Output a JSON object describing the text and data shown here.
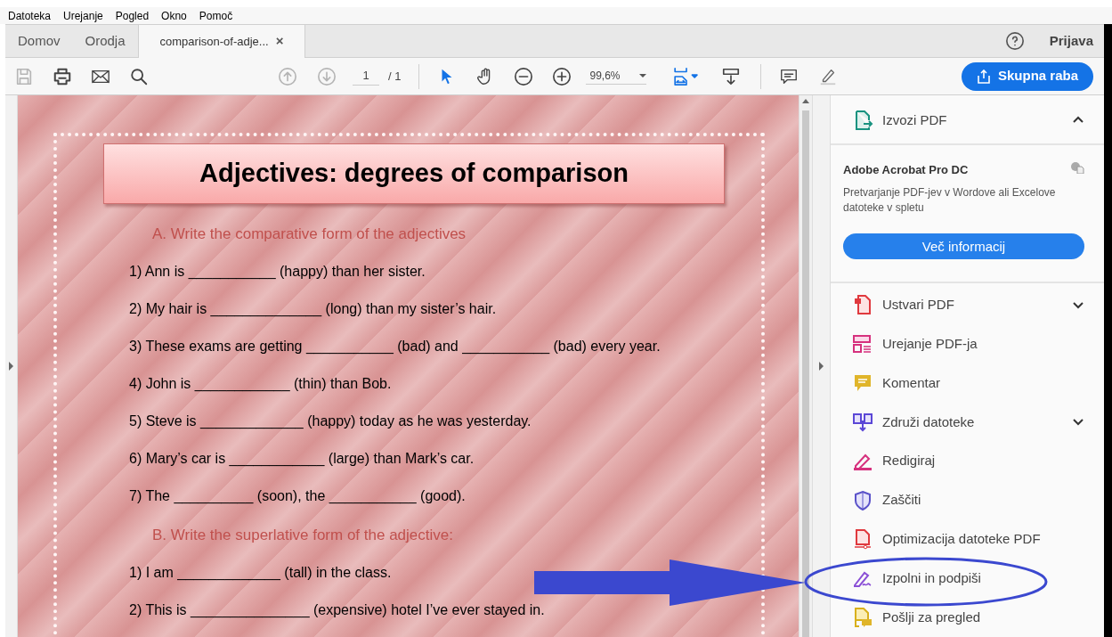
{
  "menu_bar": [
    "Datoteka",
    "Urejanje",
    "Pogled",
    "Okno",
    "Pomoč"
  ],
  "tabs": [
    {
      "label": "Domov",
      "selected": false
    },
    {
      "label": "Orodja",
      "selected": false
    },
    {
      "label": "comparison-of-adje...",
      "selected": true,
      "close": "×"
    }
  ],
  "account": {
    "sign_in": "Prijava"
  },
  "toolbar": {
    "page": "1",
    "page_total": "/ 1",
    "zoom": "99,6%",
    "share_button": "Skupna raba"
  },
  "document": {
    "title": "Adjectives: degrees of comparison",
    "sections": [
      {
        "heading": "A.  Write the comparative form of the adjectives",
        "items": [
          "1) Ann is ___________ (happy) than her sister.",
          "2) My hair is ______________ (long) than my sister’s hair.",
          "3) These exams are getting ___________ (bad) and ___________ (bad) every year.",
          "4) John is ____________ (thin) than Bob.",
          "5) Steve is _____________ (happy) today as he was yesterday.",
          "6) Mary’s car is ____________ (large) than Mark’s car.",
          "7) The __________ (soon), the ___________ (good)."
        ]
      },
      {
        "heading": "B.  Write the superlative form of the adjective:",
        "items": [
          "1) I am _____________ (tall) in the class.",
          "2) This is _______________ (expensive) hotel I’ve ever stayed in."
        ]
      }
    ]
  },
  "tools_panel": {
    "export": {
      "label": "Izvozi PDF",
      "expanded": true
    },
    "promo": {
      "title": "Adobe Acrobat Pro DC",
      "text": "Pretvarjanje PDF-jev v Wordove ali Excelove datoteke v spletu",
      "button": "Več informacij"
    },
    "items": [
      {
        "label": "Ustvari PDF",
        "expandable": true
      },
      {
        "label": "Urejanje PDF-ja",
        "expandable": false
      },
      {
        "label": "Komentar",
        "expandable": false
      },
      {
        "label": "Združi datoteke",
        "expandable": true
      },
      {
        "label": "Redigiraj",
        "expandable": false
      },
      {
        "label": "Zaščiti",
        "expandable": false
      },
      {
        "label": "Optimizacija datoteke PDF",
        "expandable": false
      },
      {
        "label": "Izpolni in podpiši",
        "expandable": false
      },
      {
        "label": "Pošlji za pregled",
        "expandable": false
      }
    ]
  }
}
